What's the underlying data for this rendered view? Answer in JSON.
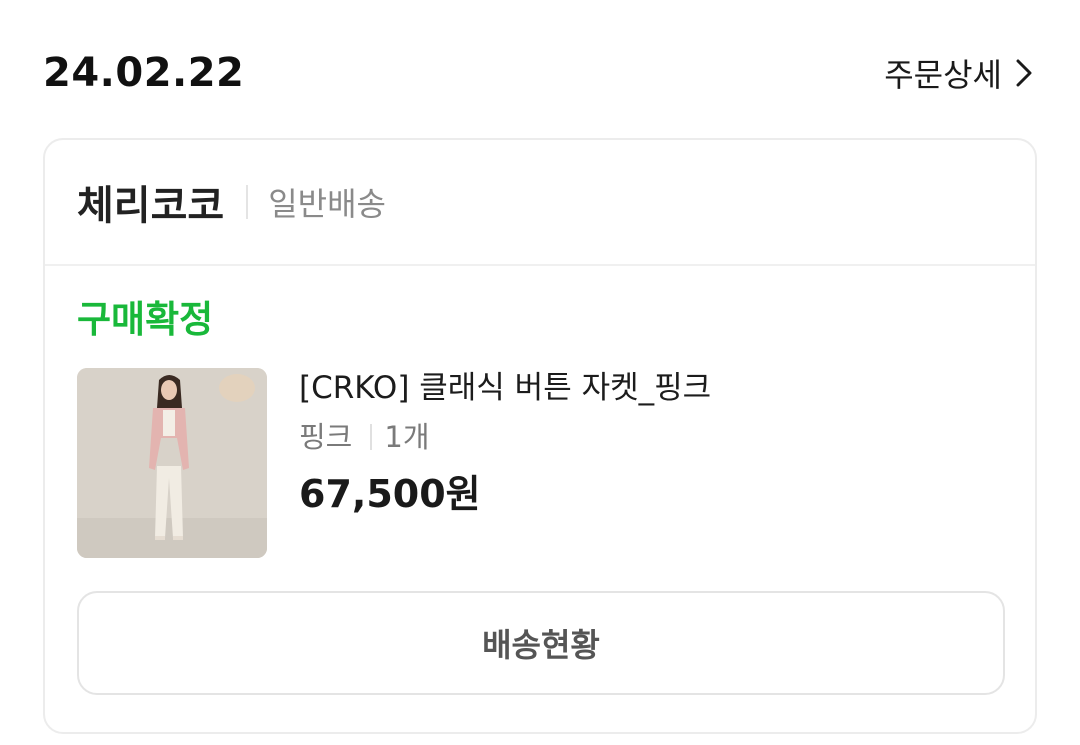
{
  "order": {
    "date": "24.02.22",
    "detail_link_label": "주문상세"
  },
  "seller": {
    "name": "체리코코",
    "shipping_type": "일반배송"
  },
  "status": {
    "label": "구매확정",
    "color": "#19b83a"
  },
  "product": {
    "name": "[CRKO] 클래식 버튼 자켓_핑크",
    "option": "핑크",
    "quantity": "1개",
    "price": "67,500원"
  },
  "actions": {
    "track_label": "배송현황"
  },
  "icons": {
    "detail_chevron": "chevron-right-icon"
  }
}
